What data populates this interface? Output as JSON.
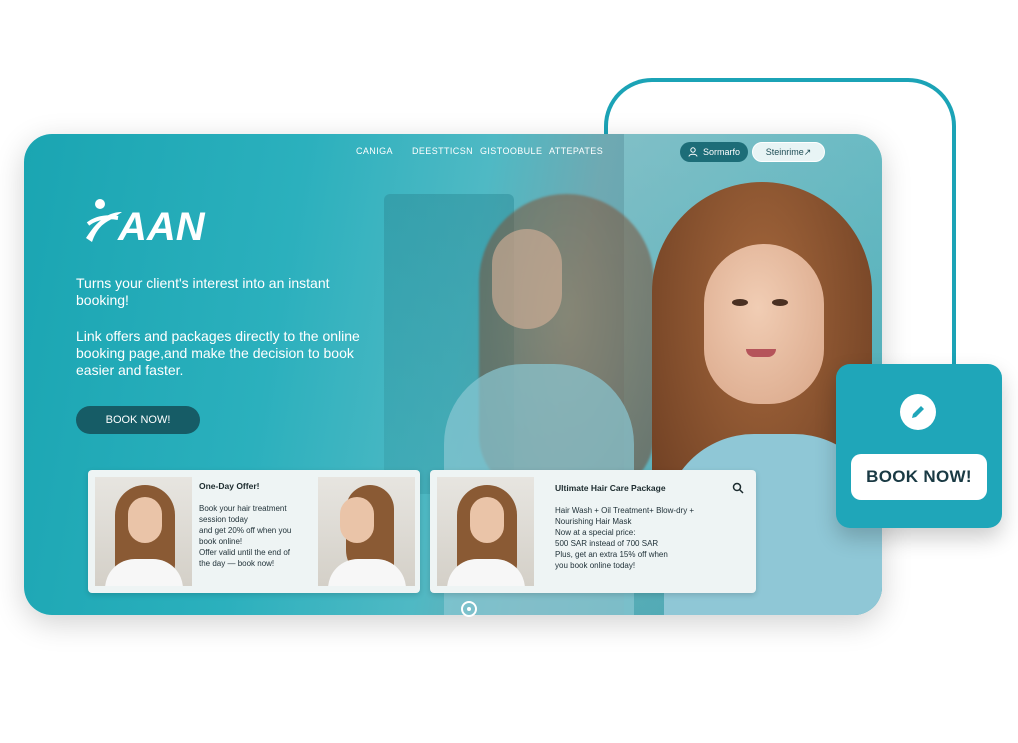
{
  "nav": {
    "items": [
      "CANIGA",
      "DEESTTICSN",
      "GISTOOBULE",
      "ATTEPATES"
    ],
    "signin_label": "Sormarfo",
    "signup_label": "Steinrime↗"
  },
  "logo": {
    "text": "AAN"
  },
  "hero": {
    "line1": "Turns your client's interest into an instant booking!",
    "line2": "Link offers and packages directly to the online booking page,and make the decision to book easier and faster.",
    "cta": "BOOK NOW!"
  },
  "cards": [
    {
      "title": "One-Day Offer!",
      "body": "Book your hair treatment\nsession today\nand get 20% off when you\nbook online!\nOffer valid until the end of\nthe day — book now!"
    },
    {
      "title": "Ultimate Hair Care Package",
      "body": "Hair Wash + Oil Treatment+ Blow-dry +\nNourishing Hair Mask\nNow at a special price:\n 500 SAR instead of 700 SAR\nPlus, get an extra 15% off when\nyou book online today!"
    }
  ],
  "float_card": {
    "cta": "BOOK NOW!",
    "icon": "pencil-icon"
  },
  "colors": {
    "accent": "#1fa6b9",
    "dark_button": "#165c66"
  }
}
